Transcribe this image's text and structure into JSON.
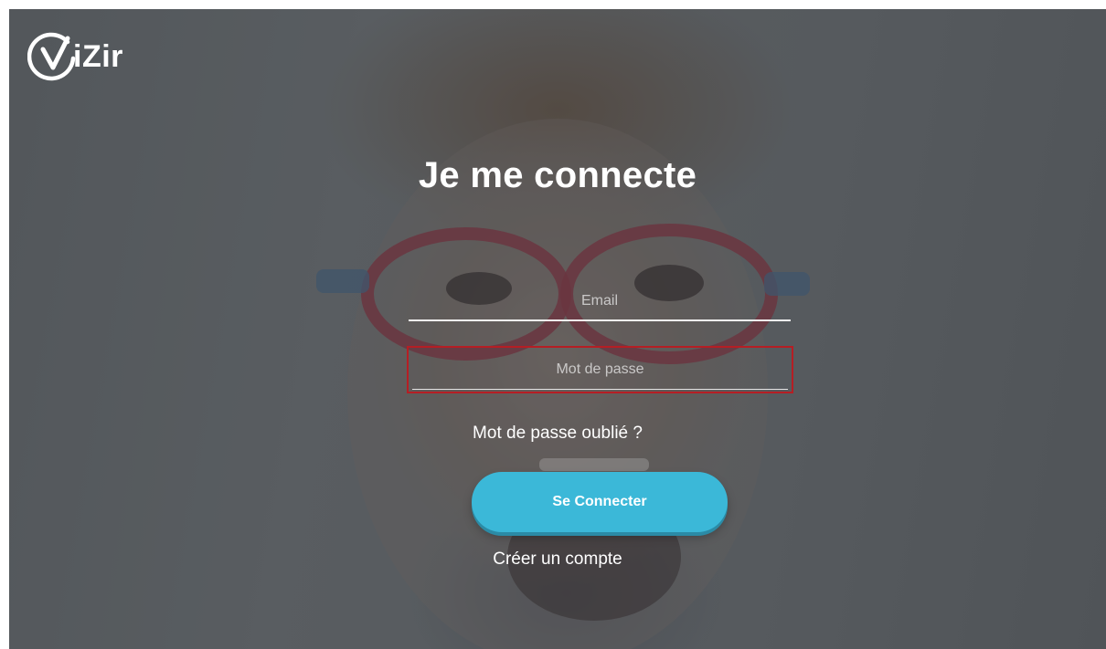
{
  "brand": {
    "name": "iZir",
    "mark_letter": "V",
    "logo_color": "#ffffff"
  },
  "login": {
    "title": "Je me connecte",
    "email_placeholder": "Email",
    "email_value": "",
    "password_placeholder": "Mot de passe",
    "password_value": "",
    "forgot_label": "Mot de passe oublié ?",
    "connect_label": "Se Connecter",
    "create_account_label": "Créer un compte"
  },
  "colors": {
    "accent_button": "#3bb8d8",
    "error_border": "#b51e24",
    "text": "#ffffff"
  },
  "icons": {
    "logo": "vizir-logo-icon"
  }
}
